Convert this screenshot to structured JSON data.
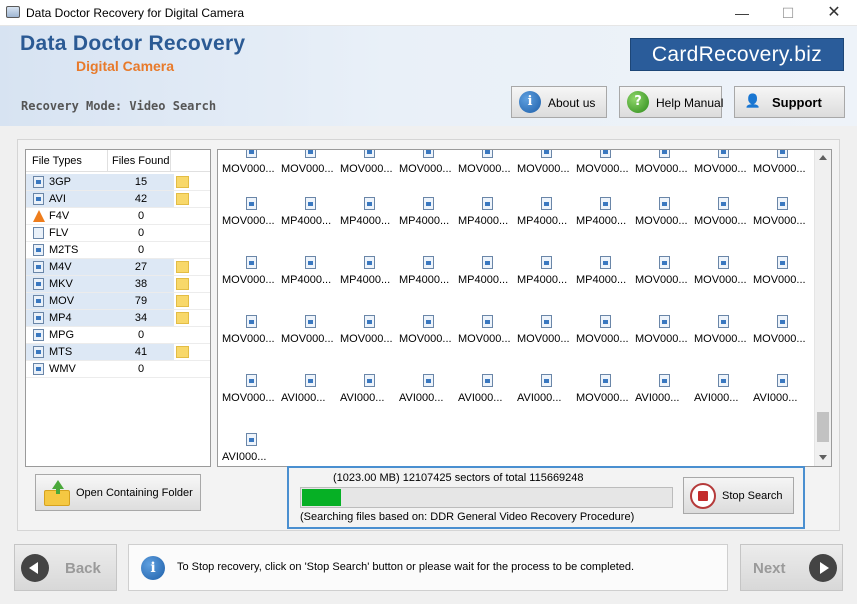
{
  "window": {
    "title": "Data Doctor Recovery for Digital Camera",
    "controls": {
      "minimize": "—",
      "maximize": "☐",
      "close": "✕"
    }
  },
  "header": {
    "brand_line1": "Data Doctor Recovery",
    "brand_line2": "Digital Camera",
    "site_badge": "CardRecovery.biz",
    "mode": "Recovery Mode: Video Search",
    "buttons": {
      "about": "About us",
      "help": "Help Manual",
      "support": "Support"
    },
    "icons": {
      "about": "i",
      "help": "?",
      "support": "👤"
    }
  },
  "file_types": {
    "headers": {
      "type": "File Types",
      "found": "Files Found"
    },
    "rows": [
      {
        "type": "3GP",
        "count": "15",
        "folder": true
      },
      {
        "type": "AVI",
        "count": "42",
        "folder": true
      },
      {
        "type": "F4V",
        "count": "0",
        "folder": false,
        "icon": "vlc"
      },
      {
        "type": "FLV",
        "count": "0",
        "folder": false,
        "icon": "blank"
      },
      {
        "type": "M2TS",
        "count": "0",
        "folder": false
      },
      {
        "type": "M4V",
        "count": "27",
        "folder": true
      },
      {
        "type": "MKV",
        "count": "38",
        "folder": true
      },
      {
        "type": "MOV",
        "count": "79",
        "folder": true
      },
      {
        "type": "MP4",
        "count": "34",
        "folder": true
      },
      {
        "type": "MPG",
        "count": "0",
        "folder": false
      },
      {
        "type": "MTS",
        "count": "41",
        "folder": true
      },
      {
        "type": "WMV",
        "count": "0",
        "folder": false
      }
    ],
    "open_folder_label": "Open Containing Folder"
  },
  "files": {
    "rows": [
      [
        "MOV000...",
        "MOV000...",
        "MOV000...",
        "MOV000...",
        "MOV000...",
        "MOV000...",
        "MOV000...",
        "MOV000...",
        "MOV000...",
        "MOV000..."
      ],
      [
        "MOV000...",
        "MP4000...",
        "MP4000...",
        "MP4000...",
        "MP4000...",
        "MP4000...",
        "MP4000...",
        "MOV000...",
        "MOV000...",
        "MOV000..."
      ],
      [
        "MOV000...",
        "MP4000...",
        "MP4000...",
        "MP4000...",
        "MP4000...",
        "MP4000...",
        "MP4000...",
        "MOV000...",
        "MOV000...",
        "MOV000..."
      ],
      [
        "MOV000...",
        "MOV000...",
        "MOV000...",
        "MOV000...",
        "MOV000...",
        "MOV000...",
        "MOV000...",
        "MOV000...",
        "MOV000...",
        "MOV000..."
      ],
      [
        "MOV000...",
        "AVI000...",
        "AVI000...",
        "AVI000...",
        "AVI000...",
        "AVI000...",
        "MOV000...",
        "AVI000...",
        "AVI000...",
        "AVI000..."
      ],
      [
        "AVI000..."
      ]
    ]
  },
  "progress": {
    "status": "(1023.00 MB)  12107425  sectors  of  total  115669248",
    "percent": 10.5,
    "note": "(Searching files based on:  DDR General Video Recovery Procedure)",
    "stop_label": "Stop Search",
    "fill_color": "#06b025"
  },
  "footer": {
    "back_label": "Back",
    "next_label": "Next",
    "message": "To Stop recovery, click on 'Stop Search' button or please wait for the process to be completed."
  }
}
